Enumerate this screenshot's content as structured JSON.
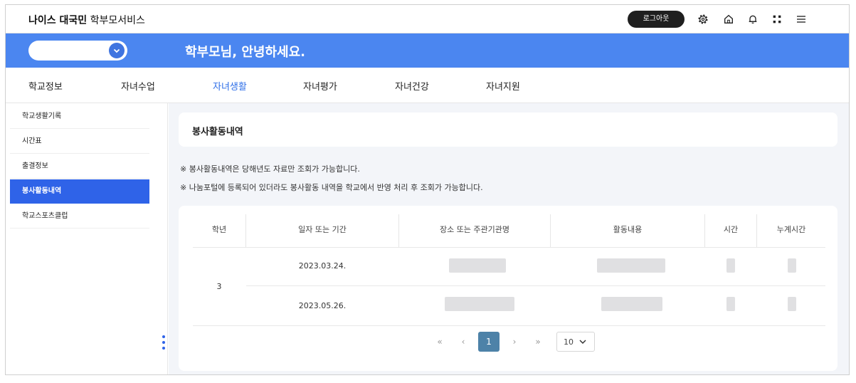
{
  "header": {
    "logo_bold": "나이스 대국민",
    "logo_rest": "학부모서비스",
    "logout_label": "로그아웃",
    "icons": [
      "settings-icon",
      "home-icon",
      "bell-icon",
      "apps-grid-icon",
      "menu-icon"
    ]
  },
  "banner": {
    "greeting": "학부모님, 안녕하세요."
  },
  "tabs": [
    {
      "label": "학교정보"
    },
    {
      "label": "자녀수업"
    },
    {
      "label": "자녀생활"
    },
    {
      "label": "자녀평가"
    },
    {
      "label": "자녀건강"
    },
    {
      "label": "자녀지원"
    }
  ],
  "active_tab": "자녀생활",
  "sidebar": {
    "items": [
      {
        "label": "학교생활기록"
      },
      {
        "label": "시간표"
      },
      {
        "label": "출결정보"
      },
      {
        "label": "봉사활동내역"
      },
      {
        "label": "학교스포츠클럽"
      }
    ],
    "active_item": "봉사활동내역"
  },
  "main": {
    "title": "봉사활동내역",
    "notes": [
      "※ 봉사활동내역은 당해년도 자료만 조회가 가능합니다.",
      "※ 나눔포털에 등록되어 있더라도 봉사활동 내역을 학교에서 반영 처리 후 조회가 가능합니다."
    ],
    "table": {
      "columns": [
        "학년",
        "일자 또는 기간",
        "장소 또는 주관기관명",
        "활동내용",
        "시간",
        "누계시간"
      ],
      "grade": "3",
      "rows": [
        {
          "date": "2023.03.24."
        },
        {
          "date": "2023.05.26."
        }
      ]
    },
    "pagination": {
      "first": "«",
      "prev": "‹",
      "current_page": "1",
      "next": "›",
      "last": "»",
      "page_size": "10"
    }
  },
  "colors": {
    "banner": "#4b86f0",
    "active_tab": "#2f6fe8",
    "sidebar_active": "#2f63e8",
    "page_button": "#4d82a8"
  }
}
